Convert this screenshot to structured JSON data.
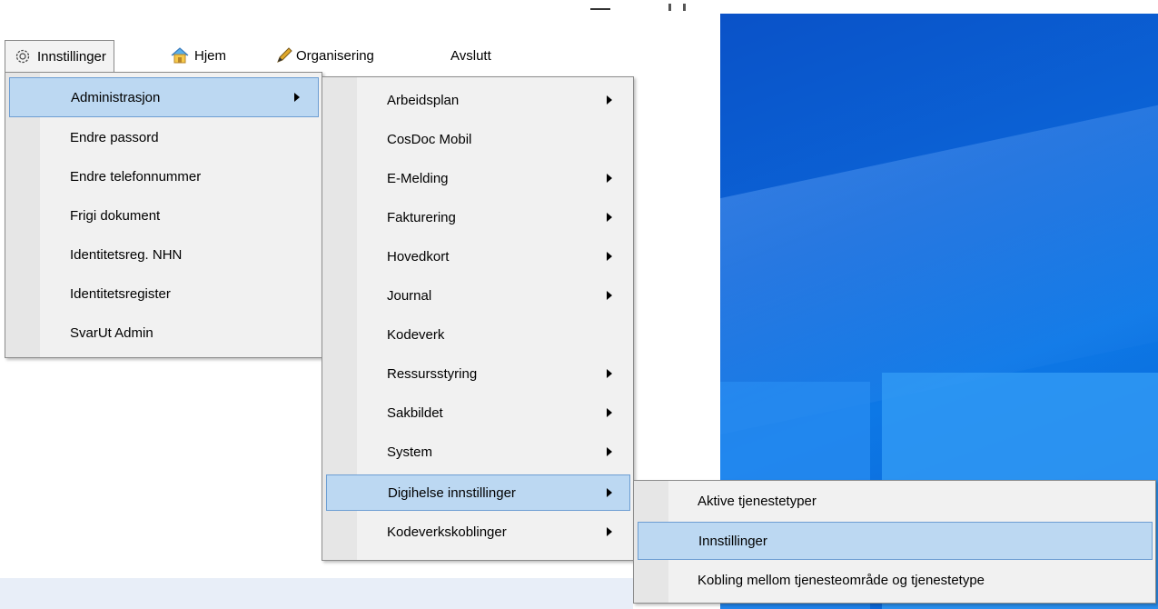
{
  "menubar": {
    "items": [
      {
        "label": "Innstillinger",
        "icon": "gear-icon"
      },
      {
        "label": "Hjem",
        "icon": "home-icon"
      },
      {
        "label": "Organisering",
        "icon": "pencil-icon"
      },
      {
        "label": "Avslutt"
      }
    ]
  },
  "menu_level1": {
    "items": [
      {
        "label": "Administrasjon",
        "submenu": true,
        "highlighted": true
      },
      {
        "label": "Endre passord"
      },
      {
        "label": "Endre telefonnummer"
      },
      {
        "label": "Frigi dokument"
      },
      {
        "label": "Identitetsreg. NHN"
      },
      {
        "label": "Identitetsregister"
      },
      {
        "label": "SvarUt Admin"
      }
    ]
  },
  "menu_level2": {
    "items": [
      {
        "label": "Arbeidsplan",
        "submenu": true
      },
      {
        "label": "CosDoc Mobil"
      },
      {
        "label": "E-Melding",
        "submenu": true
      },
      {
        "label": "Fakturering",
        "submenu": true
      },
      {
        "label": "Hovedkort",
        "submenu": true
      },
      {
        "label": "Journal",
        "submenu": true
      },
      {
        "label": "Kodeverk"
      },
      {
        "label": "Ressursstyring",
        "submenu": true
      },
      {
        "label": "Sakbildet",
        "submenu": true
      },
      {
        "label": "System",
        "submenu": true
      },
      {
        "label": "Digihelse innstillinger",
        "submenu": true,
        "highlighted": true
      },
      {
        "label": "Kodeverkskoblinger",
        "submenu": true
      }
    ]
  },
  "menu_level3": {
    "items": [
      {
        "label": "Aktive tjenestetyper"
      },
      {
        "label": "Innstillinger",
        "highlighted": true
      },
      {
        "label": "Kobling mellom tjenesteområde og tjenestetype"
      }
    ]
  },
  "colors": {
    "highlight": "#bcd8f2",
    "highlight_border": "#6d9ed3",
    "desktop": "#0b63d6"
  }
}
